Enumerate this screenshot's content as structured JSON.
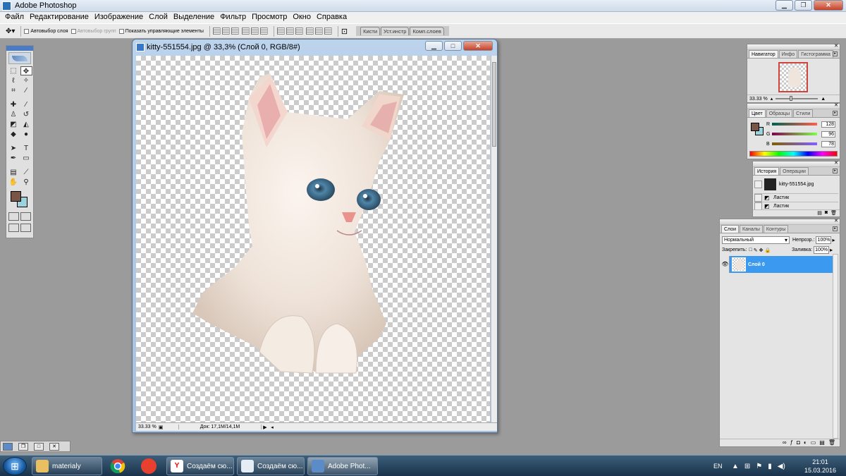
{
  "app": {
    "title": "Adobe Photoshop"
  },
  "menu": [
    "Файл",
    "Редактирование",
    "Изображение",
    "Слой",
    "Выделение",
    "Фильтр",
    "Просмотр",
    "Окно",
    "Справка"
  ],
  "options": {
    "auto_select_layer": "Автовыбор слоя",
    "auto_select_groups": "Автовыбор групп",
    "show_controls": "Показать управляющие элементы",
    "palette_well_tabs": [
      "Кисти",
      "Уст.инстр",
      "Комп.слоев"
    ]
  },
  "colors": {
    "foreground": "#795548",
    "background": "#9bd3dc",
    "accent": "#3b99f0"
  },
  "document": {
    "title": "kitty-551554.jpg @ 33,3% (Слой 0, RGB/8#)",
    "zoom": "33.33 %",
    "doc_size": "Док: 17,1M/14,1M"
  },
  "navigator": {
    "tabs": [
      "Навигатор",
      "Инфо",
      "Гистограмма"
    ],
    "zoom": "33.33 %"
  },
  "color_palette": {
    "tabs": [
      "Цвет",
      "Образцы",
      "Стили"
    ],
    "r_label": "R",
    "g_label": "G",
    "b_label": "B",
    "r": "128",
    "g": "96",
    "b": "78"
  },
  "history": {
    "tabs": [
      "История",
      "Операции"
    ],
    "snapshot": "kitty-551554.jpg",
    "steps": [
      "Ластик",
      "Ластик"
    ]
  },
  "layers": {
    "tabs": [
      "Слои",
      "Каналы",
      "Контуры"
    ],
    "blend_mode": "Нормальный",
    "opacity_label": "Непрозр.:",
    "opacity": "100%",
    "lock_label": "Закрепить:",
    "fill_label": "Заливка:",
    "fill": "100%",
    "layer_name": "Слой 0"
  },
  "taskbar": {
    "tasks": [
      "materialy",
      "Создаём сю...",
      "Создаём сю...",
      "Adobe Phot..."
    ],
    "language": "EN",
    "time": "21:01",
    "date": "15.03.2016"
  }
}
